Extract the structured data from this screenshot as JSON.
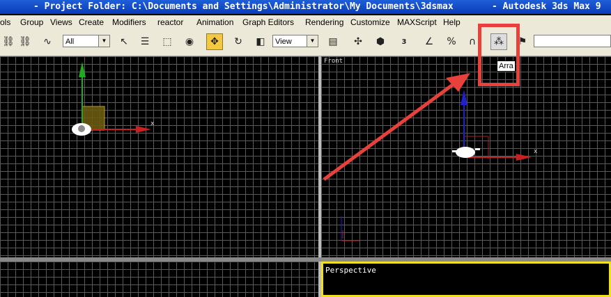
{
  "window": {
    "title_left": "- Project Folder: C:\\Documents and Settings\\Administrator\\My Documents\\3dsmax",
    "title_right": "- Autodesk 3ds Max 9"
  },
  "menu": [
    "ols",
    "Group",
    "Views",
    "Create",
    "Modifiers",
    "reactor",
    "Animation",
    "Graph Editors",
    "Rendering",
    "Customize",
    "MAXScript",
    "Help"
  ],
  "toolbar": {
    "selection_filter": "All",
    "reference_coord": "View",
    "snap_value": "3",
    "tooltip": "Arra"
  },
  "viewports": {
    "top_left_label": "",
    "front_label": "Front",
    "perspective_label": "Perspective",
    "axis_x": "x"
  },
  "colors": {
    "highlight": "#e8413c",
    "grid": "#5a5a5a",
    "active_border": "#f0e020"
  }
}
